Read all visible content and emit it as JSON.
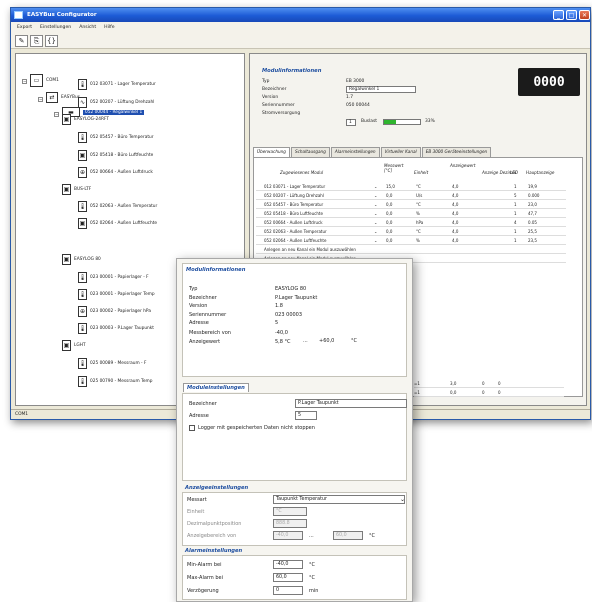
{
  "window": {
    "title": "EASYBus Configurator",
    "minimize": "_",
    "maximize": "□",
    "close": "✕"
  },
  "menu": [
    "Export",
    "Einstellungen",
    "Ansicht",
    "Hilfe"
  ],
  "tree": {
    "root": "COM1",
    "l1": "EASYBus",
    "l2": "052 00044 - Regalwinkel 1",
    "items": [
      {
        "label": "012 03071 - Lager Temperatur",
        "icon": "🌡"
      },
      {
        "label": "052 00207 - Lüftung Drehzahl",
        "icon": "∿"
      },
      {
        "label": "EASYLOG-24RFT",
        "icon": "▣"
      },
      {
        "label": "052 05457 - Büro Temperatur",
        "icon": "🌡"
      },
      {
        "label": "052 05418 - Büro Luftfeuchte",
        "icon": "▣"
      },
      {
        "label": "052 00664 - Außen Luftdruck",
        "icon": "⊕"
      },
      {
        "label": "BUS-LTF",
        "icon": "▣"
      },
      {
        "label": "052 02063 - Außen Temperatur",
        "icon": "🌡"
      },
      {
        "label": "052 02064 - Außen Luftfeuchte",
        "icon": "▣"
      },
      {
        "label": "EASYLOG 80",
        "icon": "▣"
      },
      {
        "label": "023 00001 - Papierlager - F",
        "icon": "🌡"
      },
      {
        "label": "023 00001 - Papierlager Temp",
        "icon": "🌡"
      },
      {
        "label": "023 00002 - Papierlager hPa",
        "icon": "⊕"
      },
      {
        "label": "023 00003 - P.Lager Taupunkt",
        "icon": "🌡"
      },
      {
        "label": "LGHT",
        "icon": "▣"
      },
      {
        "label": "025 00089 - Messraum - F",
        "icon": "🌡"
      },
      {
        "label": "025 00790 - Messraum Temp",
        "icon": "🌡"
      }
    ]
  },
  "module_info": {
    "title": "Modulinformationen",
    "rows": [
      {
        "k": "Typ",
        "v": "EB 3000"
      },
      {
        "k": "Bezeichner",
        "v": "Regalwinkel 1"
      },
      {
        "k": "Version",
        "v": "1.7"
      },
      {
        "k": "Seriennummer",
        "v": "050 00044"
      },
      {
        "k": "Stromversorgung",
        "v": "1"
      }
    ],
    "bus_label": "Buslast",
    "bus_pct": "33%",
    "bus_fill": 0.33,
    "lcd": "0000"
  },
  "tabs": [
    "Überwachung",
    "Schaltausgang",
    "Alarmeinstellungen",
    "Virtueller Kanal",
    "EB 3000 Geräteeinstellungen"
  ],
  "grid": {
    "headers": [
      "Zugewiesenes Modul",
      "Messwert [°C]",
      "Einheit",
      "Anzeigewert",
      "Anzeige Dezimal",
      "LED",
      "Hauptanzeige"
    ],
    "rows": [
      [
        "012 03071 - Lager Temperatur",
        "15,0",
        "°C",
        "4,0",
        "1",
        "19,9"
      ],
      [
        "052 00207 - Lüftung Drehzahl",
        "0,0",
        "U/s",
        "4,0",
        "5",
        "0.000"
      ],
      [
        "052 05457 - Büro Temperatur",
        "0,0",
        "°C",
        "4,0",
        "1",
        "23,0"
      ],
      [
        "052 05418 - Büro Luftfeuchte",
        "0,0",
        "%",
        "4,0",
        "1",
        "47,7"
      ],
      [
        "052 00664 - Außen Luftdruck",
        "0,0",
        "hPa",
        "4,0",
        "4",
        "0.05"
      ],
      [
        "052 02063 - Außen Temperatur",
        "0,0",
        "°C",
        "4,0",
        "1",
        "25,5"
      ],
      [
        "052 02064 - Außen Luftfeuchte",
        "0,0",
        "%",
        "4,0",
        "1",
        "23,5"
      ]
    ],
    "extra": [
      "Anlegen an neu Kanal ein Modul auszuwählen",
      "Anlegen an neu Kanal ein Modul auszuwählen"
    ],
    "bottom": [
      [
        "=1",
        "3,0",
        "0",
        "0"
      ],
      [
        "=1",
        "0,0",
        "0",
        "0"
      ]
    ]
  },
  "status": "COM1",
  "dialog": {
    "info_title": "Modulinformationen",
    "info": [
      {
        "k": "Typ",
        "v": "EASYLOG 80"
      },
      {
        "k": "Bezeichner",
        "v": "P.Lager Taupunkt"
      },
      {
        "k": "Version",
        "v": "1.8"
      },
      {
        "k": "Seriennummer",
        "v": "023 00003"
      },
      {
        "k": "Adresse",
        "v": "5"
      },
      {
        "k": "Messbereich von",
        "v": "-40,0"
      },
      {
        "k": "Anzeigewert",
        "v": "5,8 °C"
      }
    ],
    "range_sep": "...",
    "range_to": "+60,0",
    "range_unit": "°C",
    "settings_tab": "Moduleinstellungen",
    "bezeichner_label": "Bezeichner",
    "bezeichner_value": "P.Lager Taupunkt",
    "adresse_label": "Adresse",
    "adresse_value": "5",
    "checkbox_label": "Logger mit gespeicherten Daten nicht stoppen",
    "display_title": "Anzeigeeinstellungen",
    "messart_label": "Messart",
    "messart_value": "Taupunkt Temperatur",
    "einheit_label": "Einheit",
    "einheit_value": "°C",
    "dezimal_label": "Dezimalpunktposition",
    "dezimal_value": "888.8",
    "anzbereich_label": "Anzeigebereich von",
    "anzbereich_from": "-40,0",
    "anzbereich_to": "60,0",
    "alarm_title": "Alarmeinstellungen",
    "min_label": "Min-Alarm bei",
    "min_value": "-40,0",
    "max_label": "Max-Alarm bei",
    "max_value": "60,0",
    "delay_label": "Verzögerung",
    "delay_value": "0",
    "delay_unit": "min"
  }
}
